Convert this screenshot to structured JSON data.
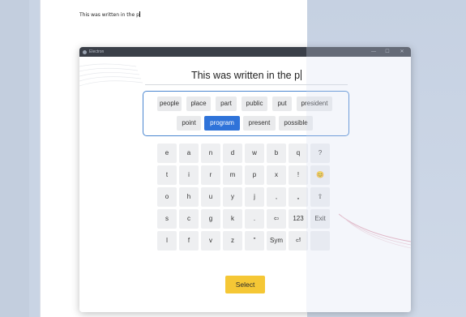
{
  "document": {
    "text": "This was written in the p"
  },
  "window": {
    "title": "Electron",
    "minimize_glyph": "—",
    "maximize_glyph": "☐",
    "close_glyph": "✕"
  },
  "keyboard": {
    "display_text": "This was written in the p",
    "suggestions": [
      {
        "label": "people",
        "selected": false
      },
      {
        "label": "place",
        "selected": false
      },
      {
        "label": "part",
        "selected": false
      },
      {
        "label": "public",
        "selected": false
      },
      {
        "label": "put",
        "selected": false
      },
      {
        "label": "president",
        "selected": false
      },
      {
        "label": "point",
        "selected": false
      },
      {
        "label": "program",
        "selected": true
      },
      {
        "label": "present",
        "selected": false
      },
      {
        "label": "possible",
        "selected": false
      }
    ],
    "rows": [
      [
        "e",
        "a",
        "n",
        "d",
        "w",
        "b",
        "q",
        "?"
      ],
      [
        "t",
        "i",
        "r",
        "m",
        "p",
        "x",
        "!",
        "😊"
      ],
      [
        "o",
        "h",
        "u",
        "y",
        "j",
        ",",
        "„",
        "⇧"
      ],
      [
        "s",
        "c",
        "g",
        "k",
        ".",
        "⇦",
        "123",
        "Exit"
      ],
      [
        "l",
        "f",
        "v",
        "z",
        "\"",
        "Sym",
        "⏎",
        ""
      ]
    ],
    "select_label": "Select"
  },
  "colors": {
    "selected_suggestion": "#2f73d9",
    "select_button": "#f5c735",
    "suggestion_border": "#4a86d0",
    "titlebar": "#3a3f48"
  }
}
